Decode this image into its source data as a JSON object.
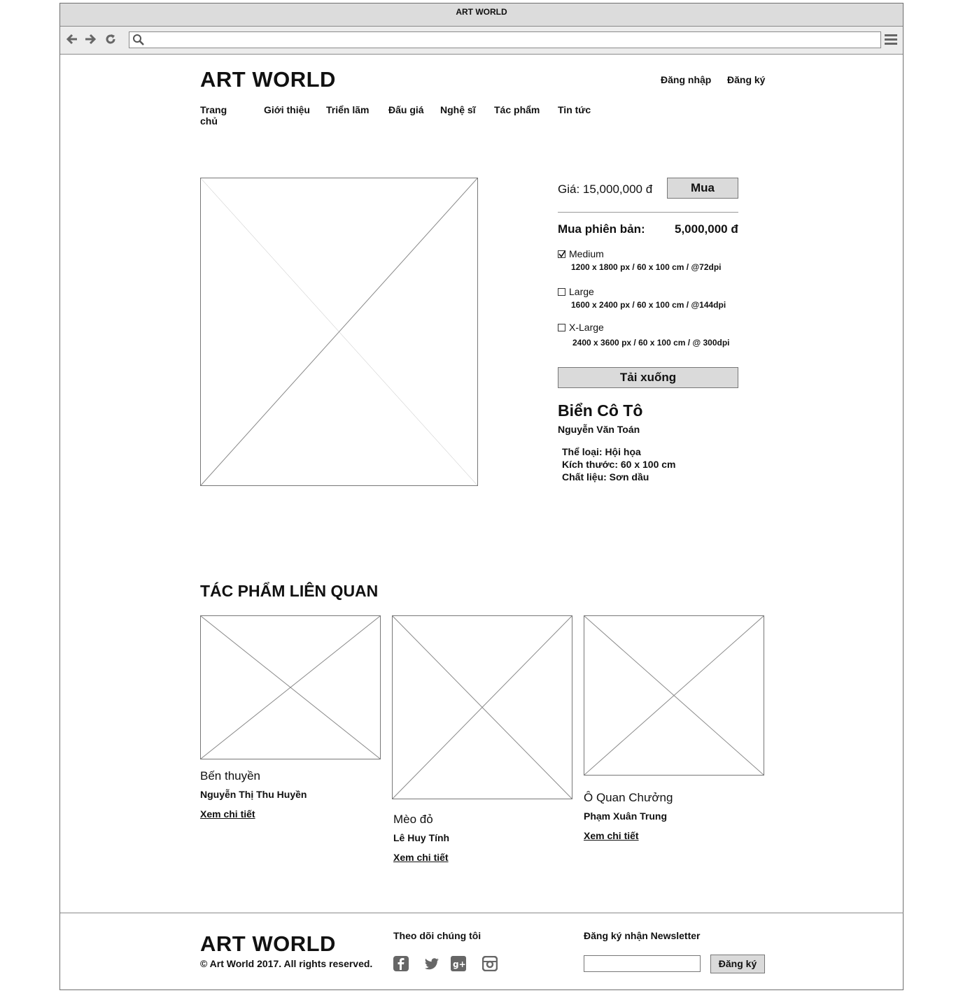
{
  "window": {
    "title": "ART WORLD"
  },
  "browser": {
    "back_icon": "arrow-left-icon",
    "forward_icon": "arrow-right-icon",
    "reload_icon": "reload-icon",
    "search_icon": "search-icon",
    "menu_icon": "hamburger-menu-icon",
    "url": ""
  },
  "header": {
    "logo": "ART WORLD",
    "login": "Đăng nhập",
    "register": "Đăng ký",
    "nav": [
      "Trang chủ",
      "Giới thiệu",
      "Triển lãm",
      "Đấu giá",
      "Nghệ sĩ",
      "Tác phẩm",
      "Tin tức"
    ]
  },
  "product": {
    "price_label": "Giá: 15,000,000 đ",
    "buy_button": "Mua",
    "edition_label": "Mua phiên bản:",
    "edition_price": "5,000,000 đ",
    "options": [
      {
        "name": "Medium",
        "spec": "1200 x 1800 px / 60 x 100 cm / @72dpi",
        "checked": true
      },
      {
        "name": "Large",
        "spec": "1600 x 2400 px / 60 x 100 cm / @144dpi",
        "checked": false
      },
      {
        "name": "X-Large",
        "spec": "2400 x 3600 px / 60 x 100 cm / @ 300dpi",
        "checked": false
      }
    ],
    "download_button": "Tải xuống",
    "title": "Biển Cô Tô",
    "artist": "Nguyễn Văn Toán",
    "genre": "Thể loại: Hội họa",
    "size": "Kích thước: 60 x 100 cm",
    "material": "Chất liệu: Sơn dầu"
  },
  "related": {
    "heading": "TÁC PHẨM LIÊN QUAN",
    "items": [
      {
        "title": "Bến thuyền",
        "artist": "Nguyễn Thị Thu Huyền",
        "link": "Xem chi tiết"
      },
      {
        "title": "Mèo đỏ",
        "artist": "Lê Huy Tính",
        "link": "Xem chi tiết"
      },
      {
        "title": "Ô Quan Chưởng",
        "artist": "Phạm Xuân Trung",
        "link": "Xem chi tiết"
      }
    ]
  },
  "footer": {
    "logo": "ART WORLD",
    "copyright": "© Art World 2017. All rights reserved.",
    "follow_label": "Theo dõi chúng tôi",
    "social_icons": [
      "facebook-icon",
      "twitter-icon",
      "google-plus-icon",
      "instagram-icon"
    ],
    "newsletter_label": "Đăng ký nhận Newsletter",
    "newsletter_value": "",
    "newsletter_button": "Đăng ký"
  }
}
